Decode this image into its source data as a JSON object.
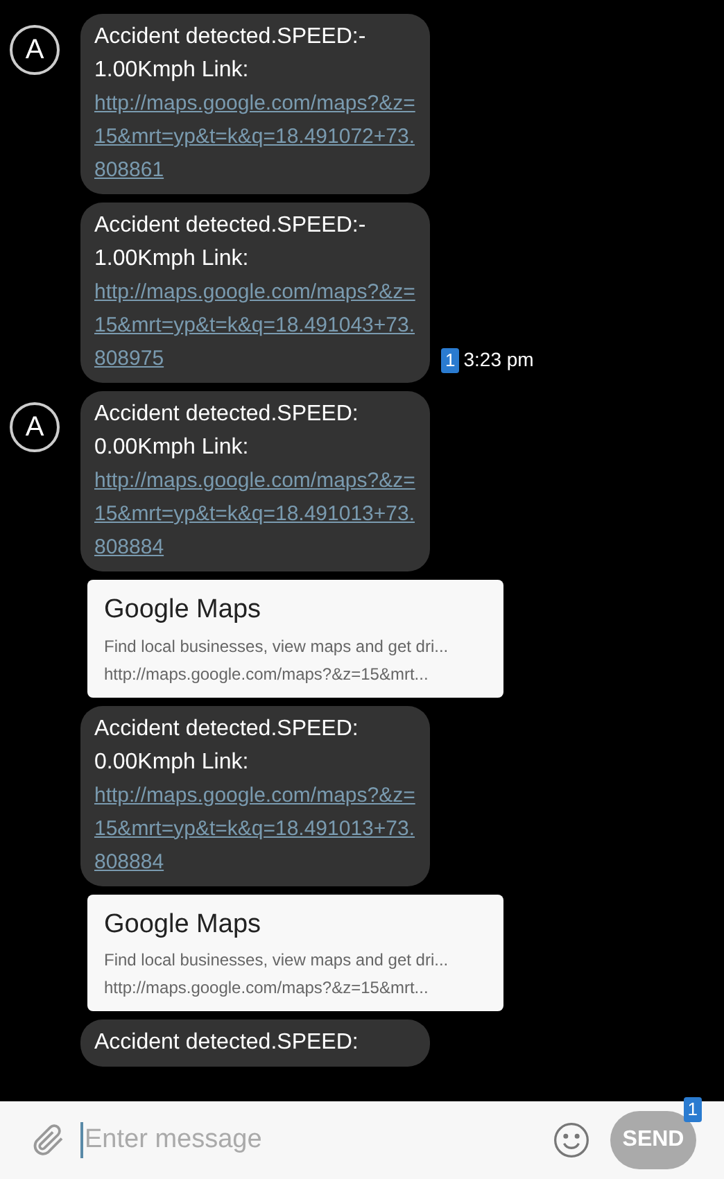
{
  "messages": [
    {
      "show_avatar": true,
      "avatar": "A",
      "text_lines": [
        "Accident detected.SPEED:-",
        "1.00Kmph Link:"
      ],
      "link": "http://maps.google.com/maps?&z=15&mrt=yp&t=k&q=18.491072+73.808861"
    },
    {
      "show_avatar": false,
      "text_lines": [
        "Accident detected.SPEED:-",
        "1.00Kmph Link:"
      ],
      "link": "http://maps.google.com/maps?&z=15&mrt=yp&t=k&q=18.491043+73.808975",
      "time": "3:23 pm",
      "sim": "1"
    },
    {
      "show_avatar": true,
      "avatar": "A",
      "text_lines": [
        "Accident detected.SPEED:",
        "0.00Kmph Link:"
      ],
      "link": "http://maps.google.com/maps?&z=15&mrt=yp&t=k&q=18.491013+73.808884",
      "preview": {
        "title": "Google Maps",
        "description": "Find local businesses, view maps and get dri...",
        "url": "http://maps.google.com/maps?&z=15&mrt..."
      }
    },
    {
      "show_avatar": false,
      "text_lines": [
        "Accident detected.SPEED:",
        "0.00Kmph Link:"
      ],
      "link": "http://maps.google.com/maps?&z=15&mrt=yp&t=k&q=18.491013+73.808884",
      "preview": {
        "title": "Google Maps",
        "description": "Find local businesses, view maps and get dri...",
        "url": "http://maps.google.com/maps?&z=15&mrt..."
      }
    },
    {
      "show_avatar": false,
      "text_lines": [
        "Accident detected.SPEED:"
      ]
    }
  ],
  "composer": {
    "placeholder": "Enter message",
    "send": "SEND",
    "send_badge": "1"
  }
}
